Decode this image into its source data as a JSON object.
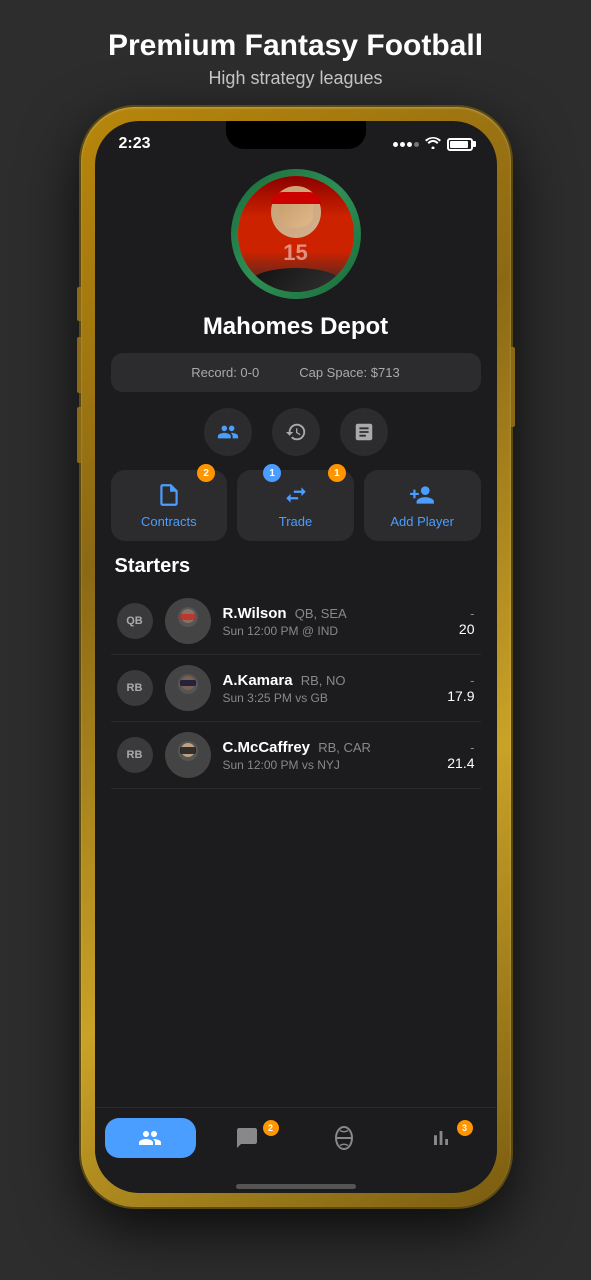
{
  "header": {
    "title": "Premium Fantasy Football",
    "subtitle": "High strategy leagues"
  },
  "status_bar": {
    "time": "2:23"
  },
  "team": {
    "name": "Mahomes Depot",
    "record_label": "Record: 0-0",
    "cap_space_label": "Cap Space: $713"
  },
  "action_icons": [
    {
      "name": "roster-icon",
      "label": "Roster"
    },
    {
      "name": "history-icon",
      "label": "History"
    },
    {
      "name": "notes-icon",
      "label": "Notes"
    }
  ],
  "action_buttons": [
    {
      "name": "contracts-btn",
      "label": "Contracts",
      "badge": "2",
      "badge_type": "orange"
    },
    {
      "name": "trade-btn",
      "label": "Trade",
      "badge_left": "1",
      "badge_right": "1",
      "badge_left_type": "blue",
      "badge_right_type": "orange"
    },
    {
      "name": "add-player-btn",
      "label": "Add Player"
    }
  ],
  "starters": {
    "title": "Starters",
    "players": [
      {
        "position": "QB",
        "name": "R.Wilson",
        "team_pos": "QB, SEA",
        "game": "Sun 12:00 PM @ IND",
        "score_dash": "-",
        "score": "20"
      },
      {
        "position": "RB",
        "name": "A.Kamara",
        "team_pos": "RB, NO",
        "game": "Sun 3:25 PM vs GB",
        "score_dash": "-",
        "score": "17.9"
      },
      {
        "position": "RB",
        "name": "C.McCaffrey",
        "team_pos": "RB, CAR",
        "game": "Sun 12:00 PM vs NYJ",
        "score_dash": "-",
        "score": "21.4"
      }
    ]
  },
  "tab_bar": {
    "tabs": [
      {
        "name": "roster-tab",
        "label": "Roster",
        "active": true,
        "badge": null
      },
      {
        "name": "chat-tab",
        "label": "Chat",
        "active": false,
        "badge": "2"
      },
      {
        "name": "football-tab",
        "label": "Scores",
        "active": false,
        "badge": null
      },
      {
        "name": "stats-tab",
        "label": "Stats",
        "active": false,
        "badge": "3"
      }
    ]
  },
  "colors": {
    "accent_blue": "#4a9eff",
    "accent_orange": "#ff9500",
    "bg_dark": "#1c1c1e",
    "bg_card": "#2c2c2e",
    "text_primary": "#ffffff",
    "text_secondary": "#aaaaaa"
  }
}
